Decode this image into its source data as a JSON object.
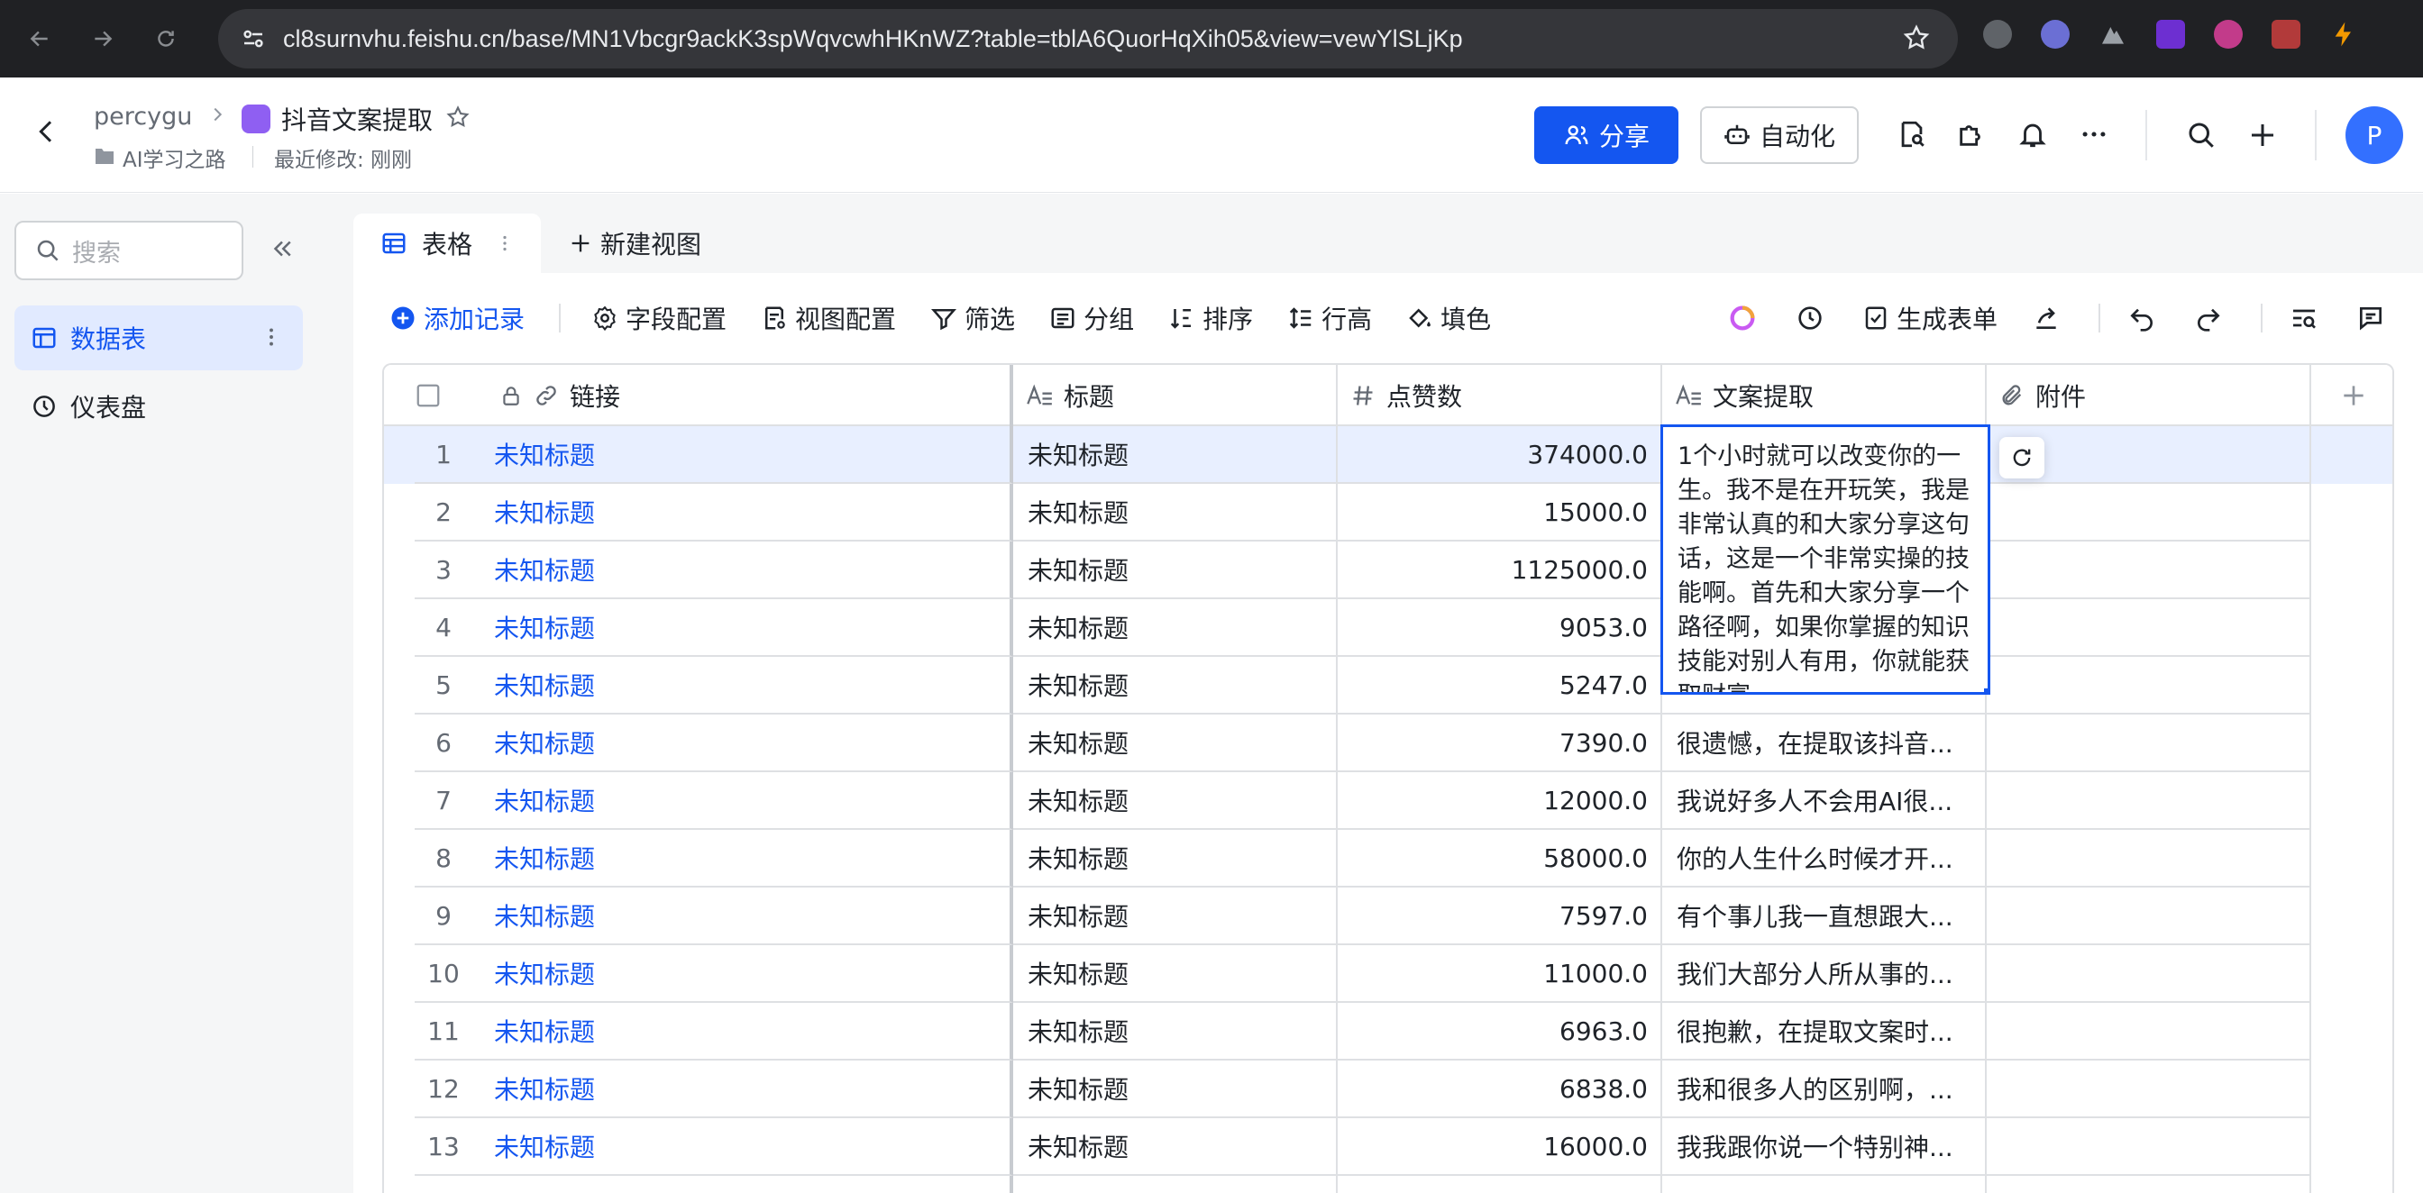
{
  "browser": {
    "url": "cl8surnvhu.feishu.cn/base/MN1Vbcgr9ackK3spWqvcwhHKnWZ?table=tblA6QuorHqXih05&view=vewYlSLjKp"
  },
  "header": {
    "owner": "percygu",
    "base_title": "抖音文案提取",
    "folder": "AI学习之路",
    "last_modified": "最近修改: 刚刚",
    "share_label": "分享",
    "automation_label": "自动化",
    "avatar_letter": "P"
  },
  "sidebar": {
    "search_placeholder": "搜索",
    "items": [
      {
        "label": "数据表"
      },
      {
        "label": "仪表盘"
      }
    ]
  },
  "tabs": {
    "active_label": "表格",
    "new_view_label": "新建视图"
  },
  "toolbar": {
    "add_record": "添加记录",
    "field_config": "字段配置",
    "view_config": "视图配置",
    "filter": "筛选",
    "group": "分组",
    "sort": "排序",
    "row_height": "行高",
    "fill_color": "填色",
    "generate_form": "生成表单"
  },
  "table": {
    "columns": [
      "链接",
      "标题",
      "点赞数",
      "文案提取",
      "附件"
    ],
    "expanded_text": "1个小时就可以改变你的一生。我不是在开玩笑，我是非常认真的和大家分享这句话，这是一个非常实操的技能啊。首先和大家分享一个路径啊，如果你掌握的知识技能对别人有用，你就能获取财富",
    "rows": [
      {
        "num": "1",
        "link": "未知标题",
        "title": "未知标题",
        "likes": "374000.0",
        "copy": ""
      },
      {
        "num": "2",
        "link": "未知标题",
        "title": "未知标题",
        "likes": "15000.0",
        "copy": ""
      },
      {
        "num": "3",
        "link": "未知标题",
        "title": "未知标题",
        "likes": "1125000.0",
        "copy": ""
      },
      {
        "num": "4",
        "link": "未知标题",
        "title": "未知标题",
        "likes": "9053.0",
        "copy": ""
      },
      {
        "num": "5",
        "link": "未知标题",
        "title": "未知标题",
        "likes": "5247.0",
        "copy": ""
      },
      {
        "num": "6",
        "link": "未知标题",
        "title": "未知标题",
        "likes": "7390.0",
        "copy": "很遗憾，在提取该抖音..."
      },
      {
        "num": "7",
        "link": "未知标题",
        "title": "未知标题",
        "likes": "12000.0",
        "copy": "我说好多人不会用AI很..."
      },
      {
        "num": "8",
        "link": "未知标题",
        "title": "未知标题",
        "likes": "58000.0",
        "copy": "你的人生什么时候才开..."
      },
      {
        "num": "9",
        "link": "未知标题",
        "title": "未知标题",
        "likes": "7597.0",
        "copy": "有个事儿我一直想跟大..."
      },
      {
        "num": "10",
        "link": "未知标题",
        "title": "未知标题",
        "likes": "11000.0",
        "copy": "我们大部分人所从事的..."
      },
      {
        "num": "11",
        "link": "未知标题",
        "title": "未知标题",
        "likes": "6963.0",
        "copy": "很抱歉，在提取文案时..."
      },
      {
        "num": "12",
        "link": "未知标题",
        "title": "未知标题",
        "likes": "6838.0",
        "copy": "我和很多人的区别啊，..."
      },
      {
        "num": "13",
        "link": "未知标题",
        "title": "未知标题",
        "likes": "16000.0",
        "copy": "我我跟你说一个特别神..."
      }
    ]
  },
  "colors": {
    "accent": "#1456f0",
    "selected_row": "#e8efff",
    "sidebar_active": "#e1eaff"
  }
}
